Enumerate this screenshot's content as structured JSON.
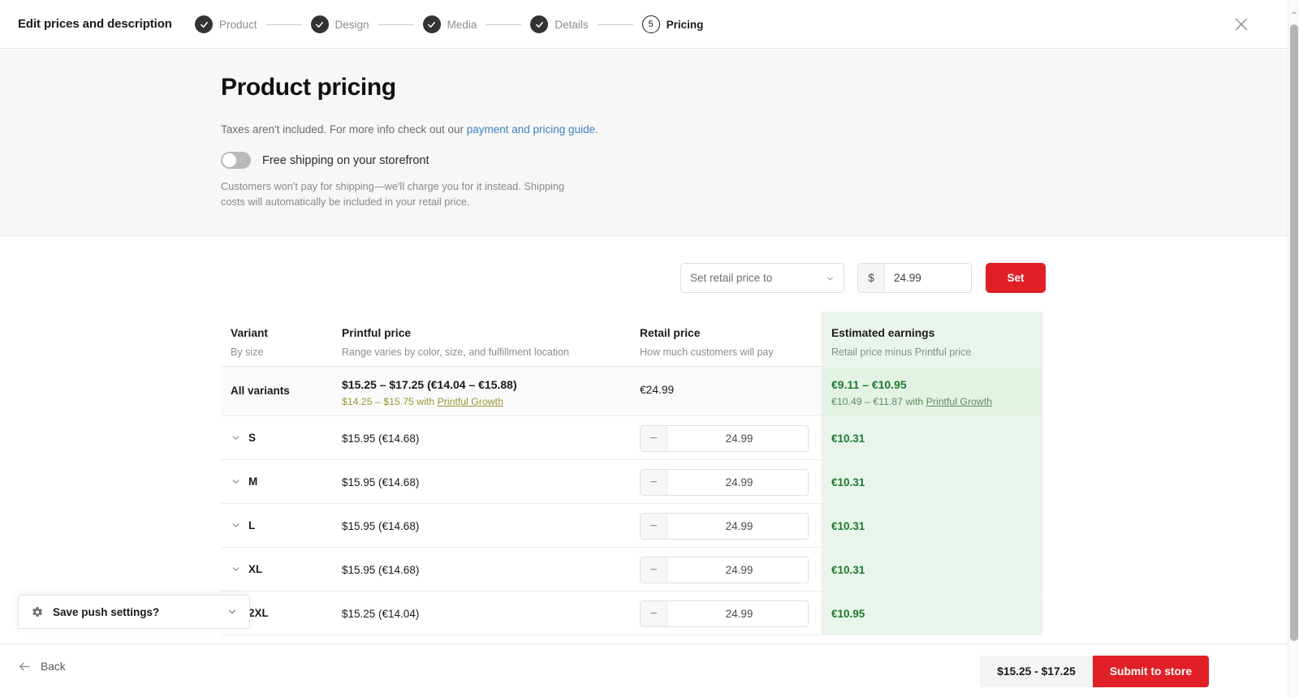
{
  "header": {
    "title": "Edit prices and description",
    "close_icon": "close-icon",
    "steps": [
      {
        "label": "Product",
        "state": "done",
        "marker": "✓"
      },
      {
        "label": "Design",
        "state": "done",
        "marker": "✓"
      },
      {
        "label": "Media",
        "state": "done",
        "marker": "✓"
      },
      {
        "label": "Details",
        "state": "done",
        "marker": "✓"
      },
      {
        "label": "Pricing",
        "state": "current",
        "marker": "5"
      }
    ]
  },
  "hero": {
    "title": "Product pricing",
    "tax_note_prefix": "Taxes aren't included. For more info check out our ",
    "tax_note_link": "payment and pricing guide",
    "tax_note_suffix": ".",
    "toggle_label": "Free shipping on your storefront",
    "toggle_state": "off",
    "note": "Customers won't pay for shipping—we'll charge you for it instead. Shipping costs will automatically be included in your retail price."
  },
  "setbar": {
    "select_value": "Set retail price to",
    "currency_symbol": "$",
    "price_value": "24.99",
    "set_label": "Set"
  },
  "table": {
    "columns": [
      {
        "title": "Variant",
        "subtitle": "By size"
      },
      {
        "title": "Printful price",
        "subtitle": "Range varies by color, size, and fulfillment location"
      },
      {
        "title": "Retail price",
        "subtitle": "How much customers will pay"
      },
      {
        "title": "Estimated earnings",
        "subtitle": "Retail price minus Printful price"
      }
    ],
    "all_variants": {
      "name": "All variants",
      "printful_price": "$15.25 – $17.25 (€14.04 – €15.88)",
      "growth_prefix": "$14.25 – $15.75 with ",
      "growth_link": "Printful Growth",
      "retail_price": "€24.99",
      "earnings": "€9.11 – €10.95",
      "earnings_growth_prefix": "€10.49 – €11.87 with ",
      "earnings_growth_link": "Printful Growth"
    },
    "variants": [
      {
        "name": "S",
        "printful_price": "$15.95 (€14.68)",
        "retail_price": "24.99",
        "earnings": "€10.31"
      },
      {
        "name": "M",
        "printful_price": "$15.95 (€14.68)",
        "retail_price": "24.99",
        "earnings": "€10.31"
      },
      {
        "name": "L",
        "printful_price": "$15.95 (€14.68)",
        "retail_price": "24.99",
        "earnings": "€10.31"
      },
      {
        "name": "XL",
        "printful_price": "$15.95 (€14.68)",
        "retail_price": "24.99",
        "earnings": "€10.31"
      },
      {
        "name": "2XL",
        "printful_price": "$15.25 (€14.04)",
        "retail_price": "24.99",
        "earnings": "€10.95"
      }
    ],
    "stepper_minus": "−",
    "stepper_plus": "+"
  },
  "push_panel": {
    "label": "Save push settings?",
    "gear_icon": "gear-icon",
    "chevron_icon": "chevron-down-icon"
  },
  "footer": {
    "back_label": "Back",
    "price_range": "$15.25 - $17.25",
    "submit_label": "Submit to store"
  },
  "colors": {
    "brand_red": "#e01f26",
    "earnings_green": "#1c7a33",
    "earnings_bg": "#e9f5ea",
    "growth_gold": "#9a9630",
    "link_blue": "#3d7fc1"
  }
}
